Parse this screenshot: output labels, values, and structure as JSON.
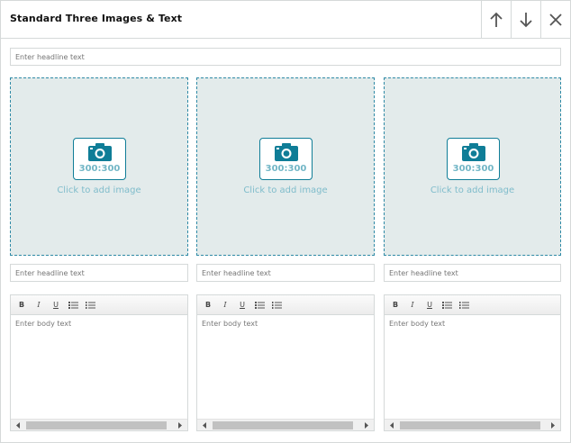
{
  "module": {
    "title": "Standard Three Images & Text",
    "move_up_icon": "arrow-up-icon",
    "move_down_icon": "arrow-down-icon",
    "close_icon": "close-icon"
  },
  "headline": {
    "placeholder": "Enter headline text"
  },
  "columns": [
    {
      "image": {
        "ratio": "300:300",
        "cta": "Click to add image"
      },
      "headline_placeholder": "Enter headline text",
      "body_placeholder": "Enter body text"
    },
    {
      "image": {
        "ratio": "300:300",
        "cta": "Click to add image"
      },
      "headline_placeholder": "Enter headline text",
      "body_placeholder": "Enter body text"
    },
    {
      "image": {
        "ratio": "300:300",
        "cta": "Click to add image"
      },
      "headline_placeholder": "Enter headline text",
      "body_placeholder": "Enter body text"
    }
  ],
  "toolbar": {
    "bold": "B",
    "italic": "I",
    "underline": "U"
  },
  "colors": {
    "accent": "#0f7d97",
    "image_bg": "#e3ebeb",
    "border": "#d5d9d9"
  }
}
